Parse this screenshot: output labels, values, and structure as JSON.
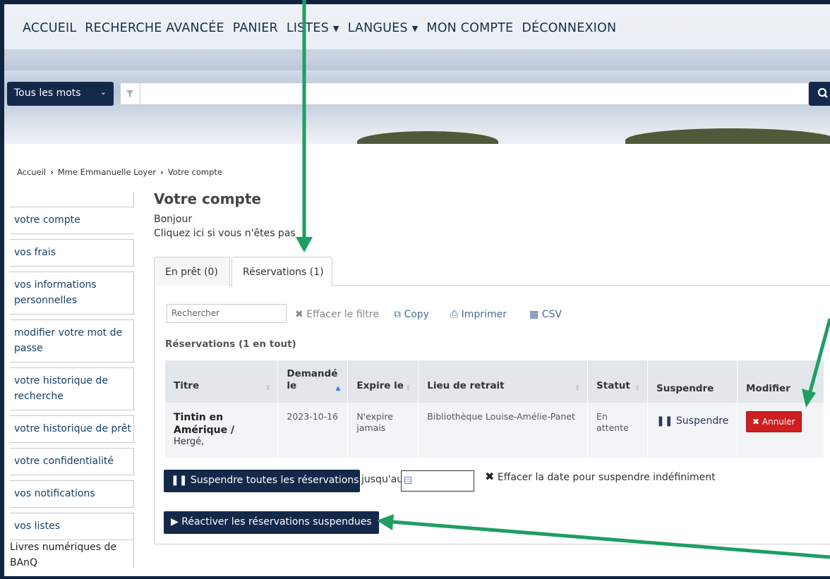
{
  "nav": {
    "items": [
      "ACCUEIL",
      "RECHERCHE AVANCÉE",
      "PANIER",
      "LISTES",
      "LANGUES",
      "MON COMPTE",
      "DÉCONNEXION"
    ]
  },
  "search": {
    "type_label": "Tous les mots",
    "value": ""
  },
  "breadcrumb": [
    "Accueil",
    "Mme Emmanuelle Loyer",
    "Votre compte"
  ],
  "sidebar": {
    "items": [
      "votre compte",
      "vos frais",
      "vos informations personnelles",
      "modifier votre mot de passe",
      "votre historique de recherche",
      "votre historique de prêt",
      "votre confidentialité",
      "vos notifications",
      "vos listes"
    ],
    "ebooks": "Livres numériques de BAnQ"
  },
  "main": {
    "title": "Votre compte",
    "greeting": "Bonjour",
    "not_you": "Cliquez ici si vous n'êtes pas",
    "tabs": [
      "En prêt (0)",
      "Réservations (1)"
    ]
  },
  "toolbar": {
    "filter_placeholder": "Rechercher",
    "clear_filter": "Effacer le filtre",
    "copy": "Copy",
    "print": "Imprimer",
    "csv": "CSV"
  },
  "holds": {
    "count_label": "Réservations (1 en tout)",
    "columns": [
      "Titre",
      "Demandé le",
      "Expire le",
      "Lieu de retrait",
      "Statut",
      "Suspendre",
      "Modifier"
    ],
    "rows": [
      {
        "title": "Tintin en Amérique /",
        "author": "Hergé,",
        "requested": "2023-10-16",
        "expires": "N'expire jamais",
        "pickup": "Bibliothèque Louise-Amélie-Panet",
        "status": "En attente",
        "suspend": "Suspendre",
        "cancel": "Annuler"
      }
    ]
  },
  "actions": {
    "suspend_all": "Suspendre toutes les réservations",
    "until": "jusqu'au",
    "clear_date": "Effacer la date pour suspendre indéfiniment",
    "resume": "Réactiver les réservations suspendues"
  },
  "colors": {
    "navy": "#14284a",
    "cancel_red": "#cd1f1f",
    "annotation_arrow": "#1e9e63"
  }
}
